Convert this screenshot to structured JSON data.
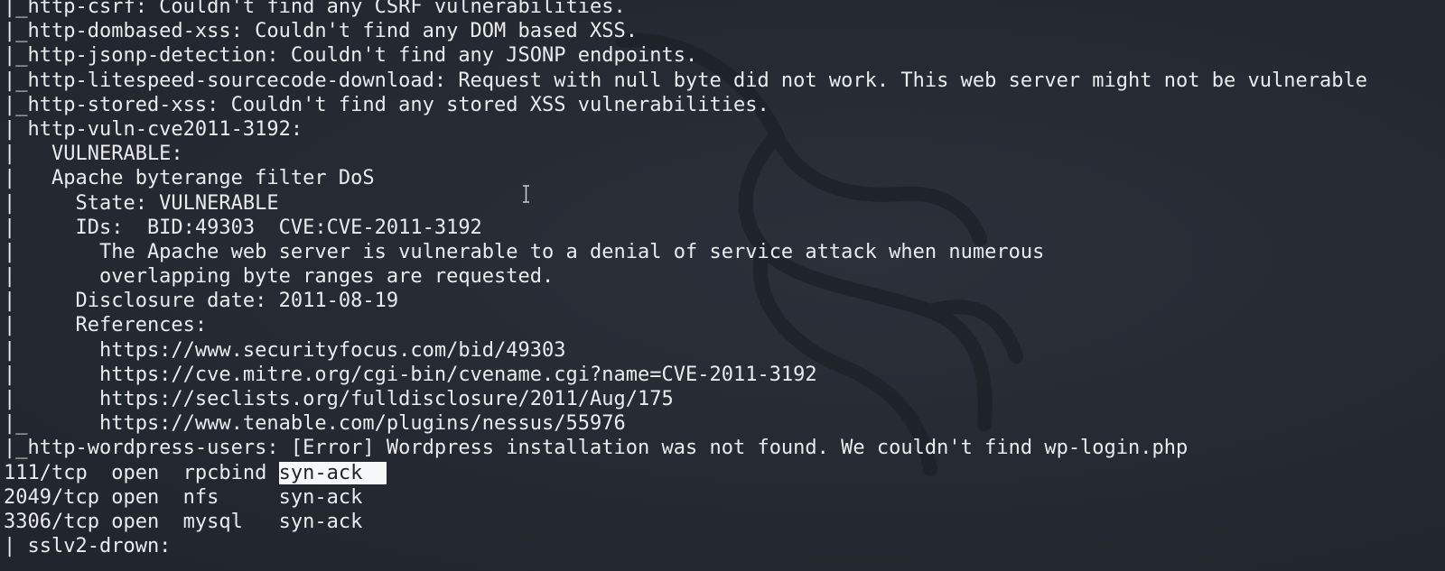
{
  "terminal": {
    "lines": [
      "|_http-csrf: Couldn't find any CSRF vulnerabilities.",
      "|_http-dombased-xss: Couldn't find any DOM based XSS.",
      "|_http-jsonp-detection: Couldn't find any JSONP endpoints.",
      "|_http-litespeed-sourcecode-download: Request with null byte did not work. This web server might not be vulnerable",
      "|_http-stored-xss: Couldn't find any stored XSS vulnerabilities.",
      "| http-vuln-cve2011-3192:",
      "|   VULNERABLE:",
      "|   Apache byterange filter DoS",
      "|     State: VULNERABLE",
      "|     IDs:  BID:49303  CVE:CVE-2011-3192",
      "|       The Apache web server is vulnerable to a denial of service attack when numerous",
      "|       overlapping byte ranges are requested.",
      "|     Disclosure date: 2011-08-19",
      "|     References:",
      "|       https://www.securityfocus.com/bid/49303",
      "|       https://cve.mitre.org/cgi-bin/cvename.cgi?name=CVE-2011-3192",
      "|       https://seclists.org/fulldisclosure/2011/Aug/175",
      "|_      https://www.tenable.com/plugins/nessus/55976",
      "|_http-wordpress-users: [Error] Wordpress installation was not found. We couldn't find wp-login.php",
      "",
      "2049/tcp open  nfs     syn-ack",
      "3306/tcp open  mysql   syn-ack",
      "| sslv2-drown:"
    ],
    "selected_line": {
      "prefix": "111/tcp  open  rpcbind ",
      "selected_text": "syn-ack  "
    }
  },
  "colors": {
    "background": "#262a33",
    "text": "#e9ebee",
    "selection_bg": "#f6f7f9",
    "selection_fg": "#1f232a"
  },
  "icons": {
    "watermark": "kali-dragon-icon",
    "cursor": "text-cursor-icon"
  }
}
